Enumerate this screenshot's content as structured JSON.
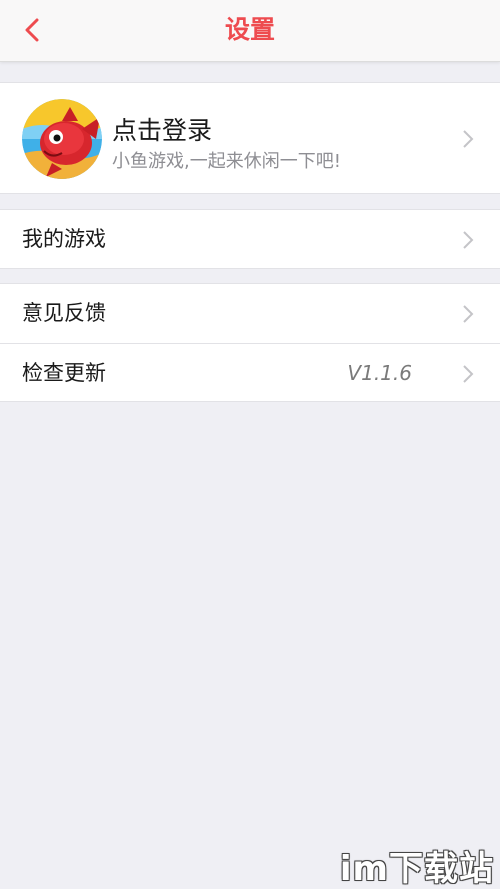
{
  "navbar": {
    "title": "设置",
    "back_icon": "chevron-left-icon",
    "accent_color": "#ee4b4f"
  },
  "profile": {
    "title": "点击登录",
    "subtitle": "小鱼游戏,一起来休闲一下吧!",
    "avatar_icon": "red-fish-avatar"
  },
  "menu": {
    "my_games": {
      "label": "我的游戏"
    },
    "feedback": {
      "label": "意见反馈"
    },
    "check_update": {
      "label": "检查更新",
      "value": "V1.1.6"
    }
  },
  "watermark": {
    "text": "im下载站"
  }
}
